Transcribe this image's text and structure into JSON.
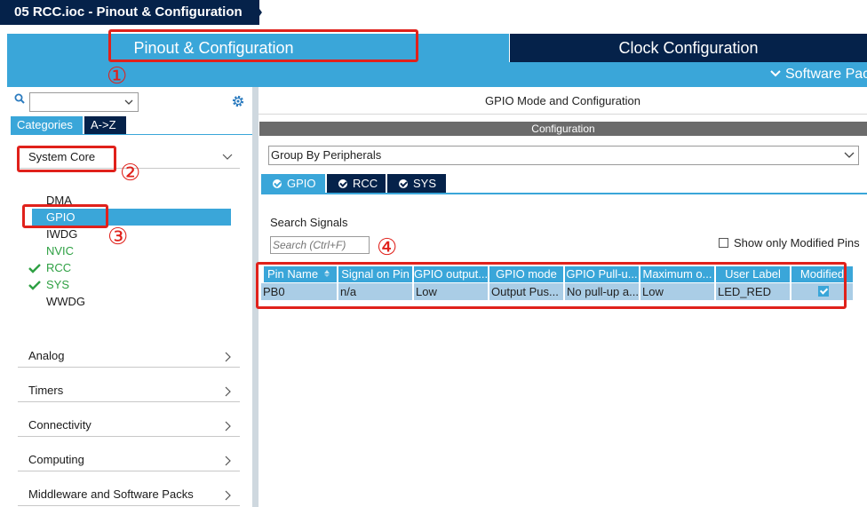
{
  "window": {
    "title": "05 RCC.ioc - Pinout & Configuration"
  },
  "tabs": {
    "pinout": "Pinout & Configuration",
    "clock": "Clock Configuration"
  },
  "subbar": {
    "software_packs": "Software Packs"
  },
  "sidebar": {
    "tabs": {
      "categories": "Categories",
      "az": "A->Z"
    },
    "groups": {
      "system_core": "System Core",
      "analog": "Analog",
      "timers": "Timers",
      "connectivity": "Connectivity",
      "computing": "Computing",
      "middleware": "Middleware and Software Packs"
    },
    "system_core_items": [
      "DMA",
      "GPIO",
      "IWDG",
      "NVIC",
      "RCC",
      "SYS",
      "WWDG"
    ]
  },
  "main": {
    "title": "GPIO Mode and Configuration",
    "config_header": "Configuration",
    "group_by": "Group By Peripherals",
    "peripheral_tabs": [
      "GPIO",
      "RCC",
      "SYS"
    ],
    "search_label": "Search Signals",
    "search_placeholder": "Search (Ctrl+F)",
    "only_modified": "Show only Modified Pins",
    "table": {
      "headers": [
        "Pin Name",
        "Signal on Pin",
        "GPIO output...",
        "GPIO mode",
        "GPIO Pull-u...",
        "Maximum o...",
        "User Label",
        "Modified"
      ],
      "row": [
        "PB0",
        "n/a",
        "Low",
        "Output Pus...",
        "No pull-up a...",
        "Low",
        "LED_RED"
      ]
    }
  },
  "annotations": [
    "①",
    "②",
    "③",
    "④"
  ],
  "colors": {
    "navy": "#05224a",
    "blue": "#3aa6d9",
    "annotation_red": "#e0211b",
    "row": "#aacde6"
  }
}
